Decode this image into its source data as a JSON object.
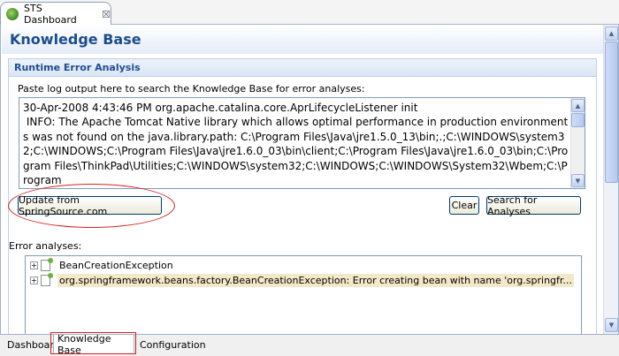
{
  "editor_tab": {
    "title": "STS Dashboard",
    "close_glyph": "☒",
    "icon": "sts-leaf-icon"
  },
  "page": {
    "title": "Knowledge Base"
  },
  "section": {
    "title": "Runtime Error Analysis"
  },
  "paste": {
    "label": "Paste log output here to search the Knowledge Base for error analyses:",
    "value": "30-Apr-2008 4:43:46 PM org.apache.catalina.core.AprLifecycleListener init\n INFO: The Apache Tomcat Native library which allows optimal performance in production environments was not found on the java.library.path: C:\\Program Files\\Java\\jre1.5.0_13\\bin;.;C:\\WINDOWS\\system32;C:\\WINDOWS;C:\\Program Files\\Java\\jre1.6.0_03\\bin\\client;C:\\Program Files\\Java\\jre1.6.0_03\\bin;C:\\Program Files\\ThinkPad\\Utilities;C:\\WINDOWS\\system32;C:\\WINDOWS;C:\\WINDOWS\\System32\\Wbem;C:\\Program"
  },
  "buttons": {
    "update": "Update from SpringSource.com",
    "clear": "Clear",
    "search": "Search for Analyses"
  },
  "errors": {
    "label": "Error analyses:",
    "items": [
      {
        "text": "BeanCreationException",
        "selected": false
      },
      {
        "text": "org.springframework.beans.factory.BeanCreationException: Error creating bean with name 'org.springfr...",
        "selected": true
      }
    ],
    "expand_glyph": "+"
  },
  "bottom_tabs": [
    {
      "label": "Dashboard",
      "active": false
    },
    {
      "label": "Knowledge Base",
      "active": true
    },
    {
      "label": "Configuration",
      "active": false
    }
  ],
  "colors": {
    "accent": "#1c4c8e",
    "annotation": "#d62222",
    "selection": "#f3e9c8"
  }
}
